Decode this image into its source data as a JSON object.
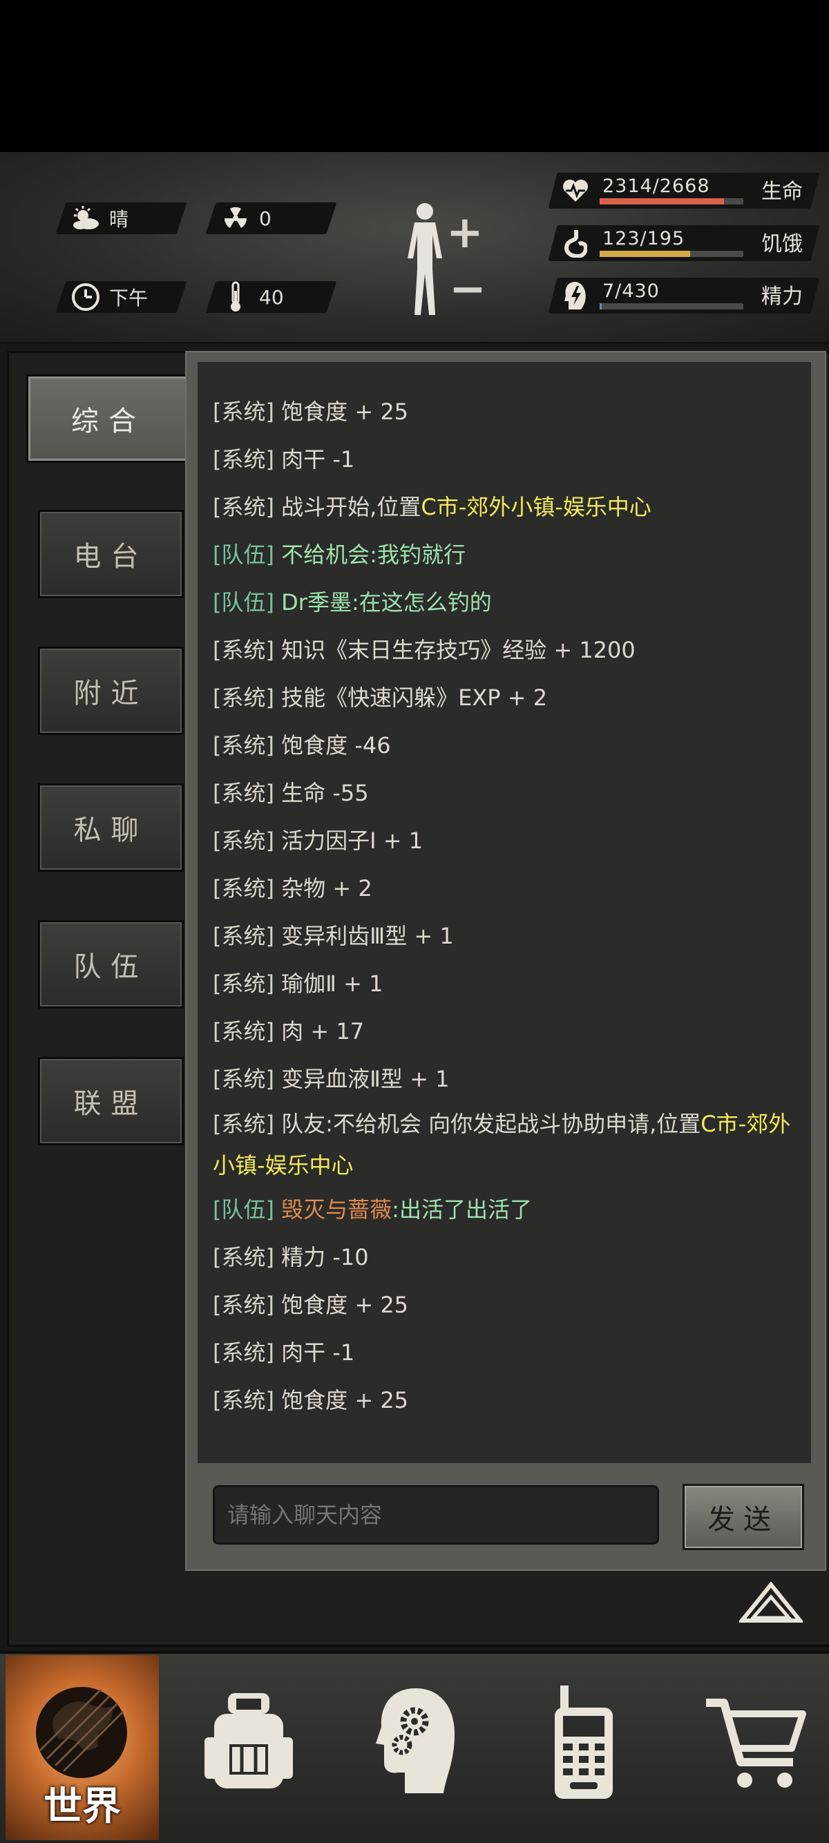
{
  "status": {
    "weather": {
      "icon": "sun-cloud-icon",
      "value": "晴"
    },
    "radiation": {
      "icon": "radiation-icon",
      "value": "0"
    },
    "time": {
      "icon": "clock-icon",
      "value": "下午"
    },
    "temperature": {
      "icon": "thermometer-icon",
      "value": "40"
    },
    "health": {
      "value": "2314/2668",
      "label": "生命",
      "current": 2314,
      "max": 2668,
      "color": "#d9614c"
    },
    "hunger": {
      "value": "123/195",
      "label": "饥饿",
      "current": 123,
      "max": 195,
      "color": "#d4a94a"
    },
    "energy": {
      "value": "7/430",
      "label": "精力",
      "current": 7,
      "max": 430,
      "color": "#5b8fd0"
    }
  },
  "tabs": [
    {
      "label": "综合",
      "active": true
    },
    {
      "label": "电台",
      "active": false
    },
    {
      "label": "附近",
      "active": false
    },
    {
      "label": "私聊",
      "active": false
    },
    {
      "label": "队伍",
      "active": false
    },
    {
      "label": "联盟",
      "active": false
    }
  ],
  "messages": [
    {
      "channel": "[系统]",
      "text": "饱食度 + 25"
    },
    {
      "channel": "[系统]",
      "text": "肉干 -1"
    },
    {
      "channel": "[系统]",
      "text": "战斗开始,位置",
      "location": "C市-郊外小镇-娱乐中心"
    },
    {
      "channel": "[队伍]",
      "text": "不给机会:我钓就行"
    },
    {
      "channel": "[队伍]",
      "text": "Dr季墨:在这怎么钓的"
    },
    {
      "channel": "[系统]",
      "text": "知识《末日生存技巧》经验 + 1200"
    },
    {
      "channel": "[系统]",
      "text": "技能《快速闪躲》EXP + 2"
    },
    {
      "channel": "[系统]",
      "text": "饱食度 -46"
    },
    {
      "channel": "[系统]",
      "text": "生命 -55"
    },
    {
      "channel": "[系统]",
      "text": "活力因子Ⅰ + 1"
    },
    {
      "channel": "[系统]",
      "text": "杂物 + 2"
    },
    {
      "channel": "[系统]",
      "text": "变异利齿Ⅲ型 + 1"
    },
    {
      "channel": "[系统]",
      "text": "瑜伽Ⅱ + 1"
    },
    {
      "channel": "[系统]",
      "text": "肉 + 17"
    },
    {
      "channel": "[系统]",
      "text": "变异血液Ⅱ型 + 1"
    },
    {
      "channel": "[系统]",
      "text": "队友:不给机会 向你发起战斗协助申请,位置",
      "location": "C市-郊外小镇-娱乐中心"
    },
    {
      "channel": "[队伍]",
      "name": "毁灭与蔷薇",
      "text": ":出活了出活了"
    },
    {
      "channel": "[系统]",
      "text": "精力 -10"
    },
    {
      "channel": "[系统]",
      "text": "饱食度 + 25"
    },
    {
      "channel": "[系统]",
      "text": "肉干 -1"
    },
    {
      "channel": "[系统]",
      "text": "饱食度 + 25"
    }
  ],
  "input": {
    "placeholder": "请输入聊天内容"
  },
  "send_label": "发送",
  "nav": {
    "world_label": "世界",
    "items": [
      "globe-icon",
      "backpack-icon",
      "head-gears-icon",
      "walkie-talkie-icon",
      "cart-icon"
    ]
  }
}
